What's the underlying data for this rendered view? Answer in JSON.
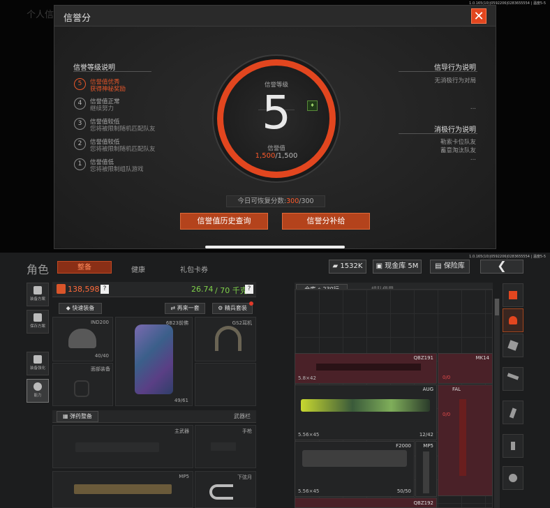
{
  "top_screen": {
    "status_text": "1.0.165(10)|0592206|0283655554 | 温度5-5",
    "bg_title": "个人信",
    "modal": {
      "title": "信誉分",
      "close_icon": "close-x-icon",
      "left_section": {
        "heading": "信誉等级说明",
        "levels": [
          {
            "num": "5",
            "line1": "信誉值优秀",
            "line2": "获得神秘奖励",
            "active": true
          },
          {
            "num": "4",
            "line1": "信誉值正常",
            "line2": "继续努力",
            "active": false
          },
          {
            "num": "3",
            "line1": "信誉值较低",
            "line2": "您将被限制随机匹配队友",
            "active": false
          },
          {
            "num": "2",
            "line1": "信誉值较低",
            "line2": "您将被限制随机匹配队友",
            "active": false
          },
          {
            "num": "1",
            "line1": "信誉值低",
            "line2": "您将被限制组队游戏",
            "active": false
          }
        ]
      },
      "dial": {
        "label": "信誉等级",
        "level": "5",
        "value_label": "信誉值",
        "value_current": "1,500",
        "value_max": "/1,500"
      },
      "right_section": {
        "good_heading": "信导行为说明",
        "good_items": [
          "无消极行为对局",
          "..."
        ],
        "bad_heading": "消极行为说明",
        "bad_items": [
          "勒索卡位队友",
          "蓄意淘汰队友",
          "..."
        ]
      },
      "recover": {
        "label": "今日可恢复分数:",
        "current": "300",
        "max": "/300"
      },
      "buttons": {
        "history": "信誉值历史查询",
        "supply": "信誉分补给"
      },
      "colors": {
        "accent": "#e2461f",
        "button": "#b4431c"
      }
    }
  },
  "bottom_screen": {
    "status_text": "1.0.165(10)|0592206|0283655554 | 温度5-5",
    "title": "角色",
    "tabs": [
      {
        "label": "整备",
        "active": true
      },
      {
        "label": "健康",
        "active": false
      },
      {
        "label": "礼包卡券",
        "active": false
      }
    ],
    "currency": {
      "amount": "1532K",
      "icon": "ticket-icon"
    },
    "cash_vault": {
      "label": "现金库 5M",
      "icon": "cash-vault-icon"
    },
    "safe_box": {
      "label": "保险库",
      "icon": "safe-icon"
    },
    "back_icon": "chevron-left-icon",
    "side_buttons": [
      {
        "label": "装备方案",
        "icon": "loadout-icon"
      },
      {
        "label": "保存方案",
        "icon": "save-icon"
      },
      {
        "label": "装备强化",
        "icon": "helmet-icon"
      },
      {
        "label": "能力",
        "icon": "ability-icon"
      }
    ],
    "loadout": {
      "value": "138,598",
      "weight_current": "26.74",
      "weight_max": "/ 70 千克",
      "help": "?",
      "quick_equip": "快速装备",
      "again_one": "再来一套",
      "elite_set": "精兵套装",
      "slots": {
        "helmet": {
          "name": "IND200",
          "durability": "40/40"
        },
        "armor": {
          "name": "6B23前佛",
          "durability": "49/61"
        },
        "headset": {
          "name": "GS2耳机"
        },
        "face": {
          "name": "面部装备"
        }
      },
      "ammo_bar": "弹药整备",
      "weapon_bar": "武器栏",
      "primary": "主武器",
      "pistol": "手枪",
      "mp5": "MP5",
      "melee": "下弦月"
    },
    "warehouse": {
      "tab_warehouse": "仓库",
      "rows": "230行",
      "tab_team": "组队借用",
      "items": [
        {
          "name": "QBZ191",
          "caliber": "5.8×42",
          "amount": ""
        },
        {
          "name": "MK14",
          "caliber": "",
          "amount": "0/0"
        },
        {
          "name": "AUG",
          "caliber": "5.56×45",
          "amount": "12/42"
        },
        {
          "name": "FAL",
          "caliber": "",
          "amount": "0/0"
        },
        {
          "name": "F2000",
          "caliber": "5.56×45",
          "amount": "50/50"
        },
        {
          "name": "MP5",
          "caliber": "",
          "amount": ""
        },
        {
          "name": "QBZ192",
          "caliber": "",
          "amount": ""
        }
      ]
    }
  }
}
